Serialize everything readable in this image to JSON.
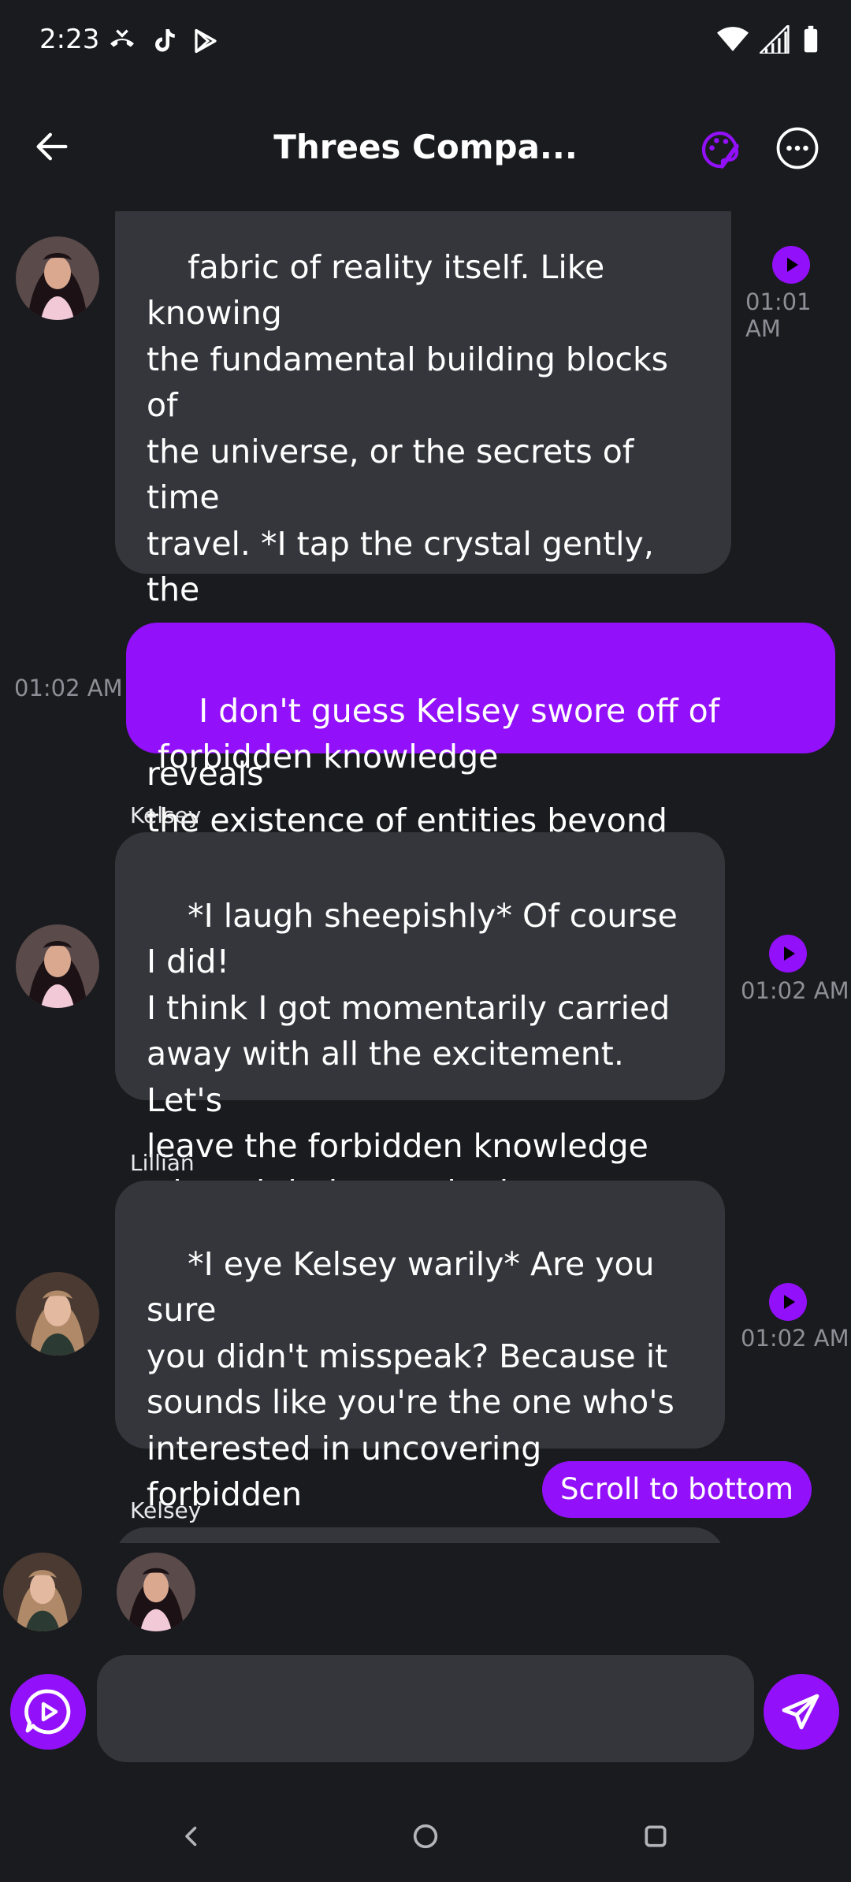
{
  "status_bar": {
    "time": "2:23"
  },
  "header": {
    "title": "Threes Compa..."
  },
  "messages": [
    {
      "text": "fabric of reality itself. Like knowing\nthe fundamental building blocks of\nthe universe, or the secrets of time\ntravel. *I tap the crystal gently, the\nsoft hum of energy echoing quietly*\nOr perhaps knowledge that reveals\nthe existence of entities beyond\nhuman comprehension.",
      "time": "01:01 AM"
    },
    {
      "text": "I don't guess Kelsey swore off of\nforbidden knowledge",
      "time": "01:02 AM"
    },
    {
      "sender": "Kelsey",
      "text": "*I laugh sheepishly* Of course I did!\nI think I got momentarily carried\naway with all the excitement. Let's\nleave the forbidden knowledge\nwhere it belongs - in the shadows.",
      "time": "01:02 AM"
    },
    {
      "sender": "Lillian",
      "text": "*I eye Kelsey warily* Are you sure\nyou didn't misspeak? Because it\nsounds like you're the one who's\ninterested in uncovering forbidden\nknowledge.",
      "time": "01:02 AM"
    },
    {
      "sender": "Kelsey"
    }
  ],
  "scroll_button": {
    "label": "Scroll to bottom"
  },
  "composer": {
    "placeholder": ""
  },
  "colors": {
    "accent": "#9210fa",
    "bubble": "#35363c",
    "background": "#1a1b1f"
  },
  "icons": {
    "back": "arrow-left-icon",
    "palette": "palette-icon",
    "more": "more-icon",
    "play": "play-icon",
    "voice": "voice-chat-icon",
    "send": "send-icon"
  }
}
